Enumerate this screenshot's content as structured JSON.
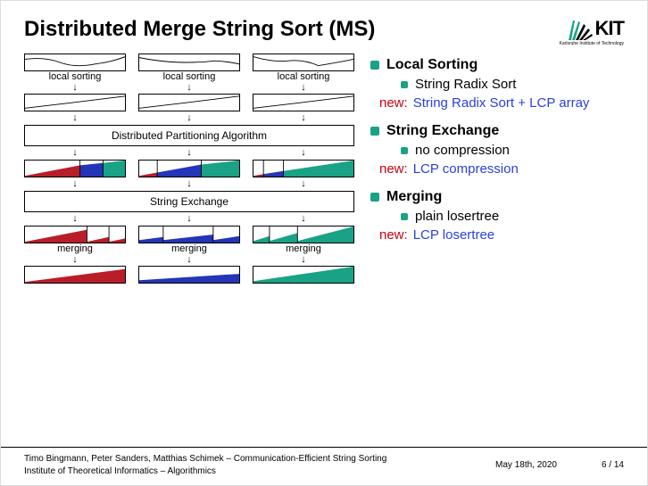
{
  "title": "Distributed Merge String Sort (MS)",
  "logo": {
    "text": "KIT",
    "sub": "Karlsruhe Institute of Technology"
  },
  "side": {
    "sections": [
      {
        "heading": "Local Sorting",
        "sub": "String Radix Sort",
        "new_label": "new:",
        "new_text": "String Radix Sort + LCP array"
      },
      {
        "heading": "String Exchange",
        "sub": "no compression",
        "new_label": "new:",
        "new_text": "LCP compression"
      },
      {
        "heading": "Merging",
        "sub": "plain losertree",
        "new_label": "new:",
        "new_text": "LCP losertree"
      }
    ]
  },
  "diagram": {
    "local_sorting_label": "local sorting",
    "partition_label": "Distributed Partitioning Algorithm",
    "string_exchange_label": "String Exchange",
    "merging_label": "merging"
  },
  "footer": {
    "authors": "Timo Bingmann, Peter Sanders, Matthias Schimek",
    "sep": " – ",
    "paper": "Communication-Efficient String Sorting",
    "institute": "Institute of Theoretical Informatics",
    "group": "Algorithmics",
    "date": "May 18th, 2020",
    "page": "6 / 14"
  },
  "colors": {
    "teal": "#19a285",
    "red": "#b91d2a",
    "blue": "#2435b8"
  }
}
